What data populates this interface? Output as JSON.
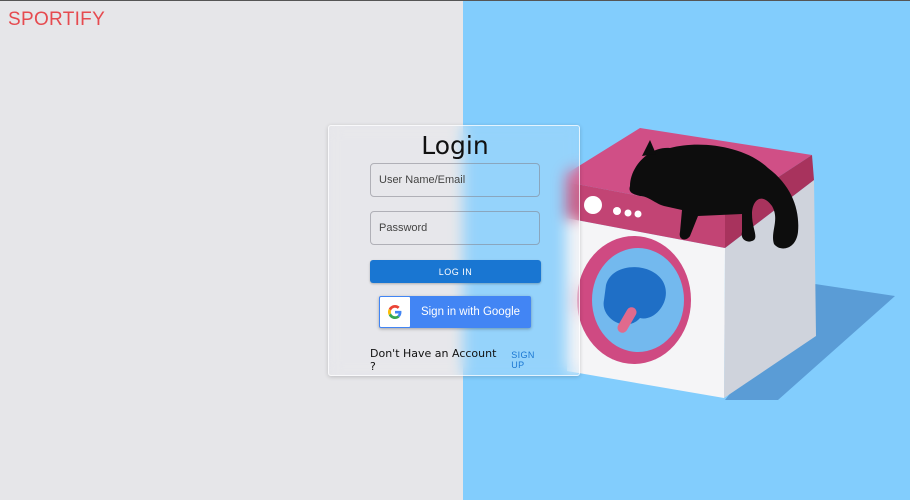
{
  "brand": {
    "name": "SPORTIFY"
  },
  "login": {
    "title": "Login",
    "username_placeholder": "User Name/Email",
    "password_placeholder": "Password",
    "login_button": "LOG IN",
    "google_button": "Sign in with Google",
    "signup_prompt": "Don't Have an Account ?",
    "signup_link": "SIGN UP"
  },
  "illustration": {
    "subject": "washing machine with sleeping black cat",
    "icon": "google-icon"
  },
  "colors": {
    "left_background": "#e6e6e9",
    "right_background": "#82cdfd",
    "brand": "#e64a4f",
    "primary_button": "#1976d2",
    "google_button": "#4285f4",
    "machine_top": "#d04f86"
  }
}
